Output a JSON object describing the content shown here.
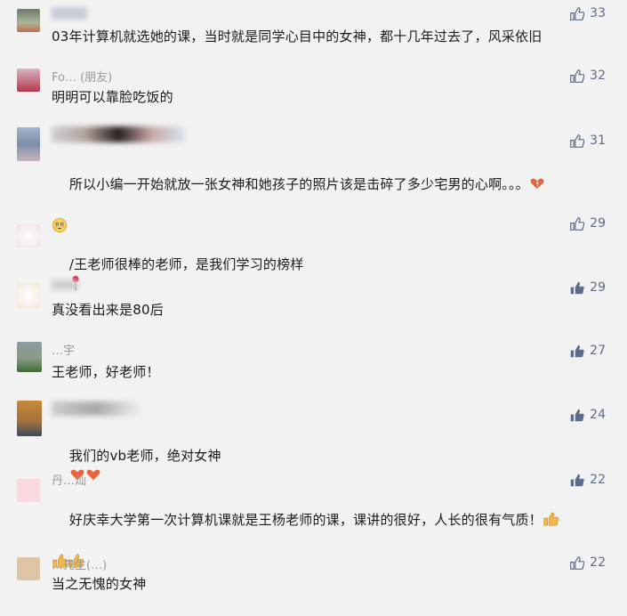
{
  "comments": [
    {
      "nickname": "",
      "text": "03年计算机就选她的课，当时就是同学心目中的女神，都十几年过去了，风采依旧",
      "likes": "33",
      "liked": false
    },
    {
      "nickname": "Fo… (朋友)",
      "text": "明明可以靠脸吃饭的",
      "likes": "32",
      "liked": false
    },
    {
      "nickname": "",
      "text": "所以小编一开始就放一张女神和她孩子的照片该是击碎了多少宅男的心啊。。。",
      "likes": "31",
      "liked": false
    },
    {
      "nickname": "",
      "text": "/王老师很棒的老师，是我们学习的榜样",
      "likes": "29",
      "liked": false
    },
    {
      "nickname": "",
      "text": "真没看出来是80后",
      "likes": "29",
      "liked": true
    },
    {
      "nickname": "…宇",
      "text": "王老师，好老师！",
      "likes": "27",
      "liked": true
    },
    {
      "nickname": "",
      "text": "我们的vb老师，绝对女神",
      "likes": "24",
      "liked": true
    },
    {
      "nickname": "丹…灿",
      "text": "好庆幸大学第一次计算机课就是王杨老师的课，课讲的很好，人长的很有气质！",
      "likes": "22",
      "liked": true
    },
    {
      "nickname": "…先生(…)",
      "text": "当之无愧的女神",
      "likes": "22",
      "liked": false
    }
  ],
  "icons": {
    "like": "thumbs-up-icon",
    "heartbreak": "broken-heart-icon",
    "rose": "rose-icon",
    "heart": "heart-icon",
    "thumb": "thumbs-up-emoji-icon",
    "flushed": "flushed-face-icon"
  },
  "colors": {
    "background": "#f2f2f2",
    "like": "#5b6b8a",
    "nickname": "#9a9a9a",
    "text": "#1a1a1a"
  }
}
